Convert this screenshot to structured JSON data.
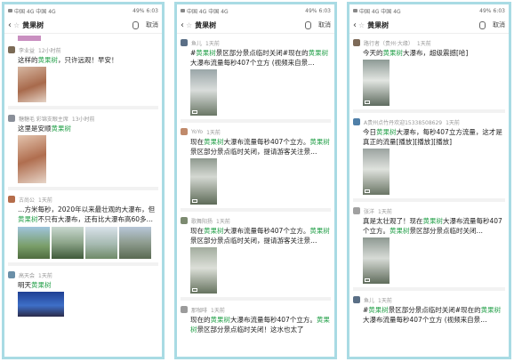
{
  "status": {
    "left": "中国 4G 中国 4G",
    "battery": "49%",
    "time": "6:03"
  },
  "search": {
    "query": "黄果树",
    "cancel_label": "取消"
  },
  "colors": {
    "highlight": "#26a14b",
    "frame": "#a9dbe4"
  },
  "panels": [
    {
      "posts": [
        {
          "author": "李业益",
          "time": "12小时前",
          "text_a": "这样的",
          "hl_a": "黄果树",
          "text_b": "，只许远观！早安！"
        },
        {
          "author": "糖糖毛 彩锦支眼主席",
          "time": "13小时前",
          "text_a": "这里是安顺",
          "hl_a": "黄果树",
          "text_b": ""
        },
        {
          "author": "古尚公",
          "time": "1天前",
          "text_a": "…方米每秒，2020年以来最壮观的大瀑布，但",
          "hl_a": "黄果树",
          "text_b": "不只有大瀑布，还有比大瀑布高60多…"
        },
        {
          "author": "高天会",
          "time": "1天前",
          "text_a": "明天",
          "hl_a": "黄果树",
          "text_b": ""
        }
      ]
    },
    {
      "posts": [
        {
          "author": "鱼儿",
          "time": "1天前",
          "text_a": "#",
          "hl_a": "黄果树",
          "text_b": "景区部分景点临时关闭#现在的",
          "hl_b": "黄果树",
          "text_c": "大瀑布流量每秒407个立方 (视频来自景…"
        },
        {
          "author": "YoYo",
          "time": "1天前",
          "text_a": "现在",
          "hl_a": "黄果树",
          "text_b": "大瀑布流量每秒407个立方。",
          "hl_b": "黄果树",
          "text_c": "景区部分景点临时关闭，提请游客关注景…"
        },
        {
          "author": "歌舞阳扬",
          "time": "1天前",
          "text_a": "现在",
          "hl_a": "黄果树",
          "text_b": "大瀑布流量每秒407个立方。",
          "hl_b": "黄果树",
          "text_c": "景区部分景点临时关闭，提请游客关注景…"
        },
        {
          "author": "那咖啡",
          "time": "1天前",
          "text_a": "现在的",
          "hl_a": "黄果树",
          "text_b": "大瀑布流量每秒407个立方。",
          "hl_b": "黄果树",
          "text_c": "景区部分景点临时关闭！这水也太了"
        }
      ]
    },
    {
      "posts": [
        {
          "author": "路行者（贵州·大缘）",
          "time": "1天前",
          "text_a": "今天的",
          "hl_a": "黄果树",
          "text_b": "大瀑布，超级震撼[哈]"
        },
        {
          "author": "A贵州点竹丹欢迎15338508629",
          "time": "1天前",
          "text_a": "今日",
          "hl_a": "黄果树",
          "text_b": "大瀑布，每秒407立方流量，这才是真正的流量[播放][播放][播放]"
        },
        {
          "author": "张洋",
          "time": "1天前",
          "text_a": "真是太壮观了！现在",
          "hl_a": "黄果树",
          "text_b": "大瀑布流量每秒407个立方。",
          "hl_b": "黄果树",
          "text_c": "景区部分景点临时关闭…"
        },
        {
          "author": "鱼儿",
          "time": "1天前",
          "text_a": "#",
          "hl_a": "黄果树",
          "text_b": "景区部分景点临时关闭#现在的",
          "hl_b": "黄果树",
          "text_c": "大瀑布流量每秒407个立方 (视频来自景…"
        }
      ]
    }
  ]
}
